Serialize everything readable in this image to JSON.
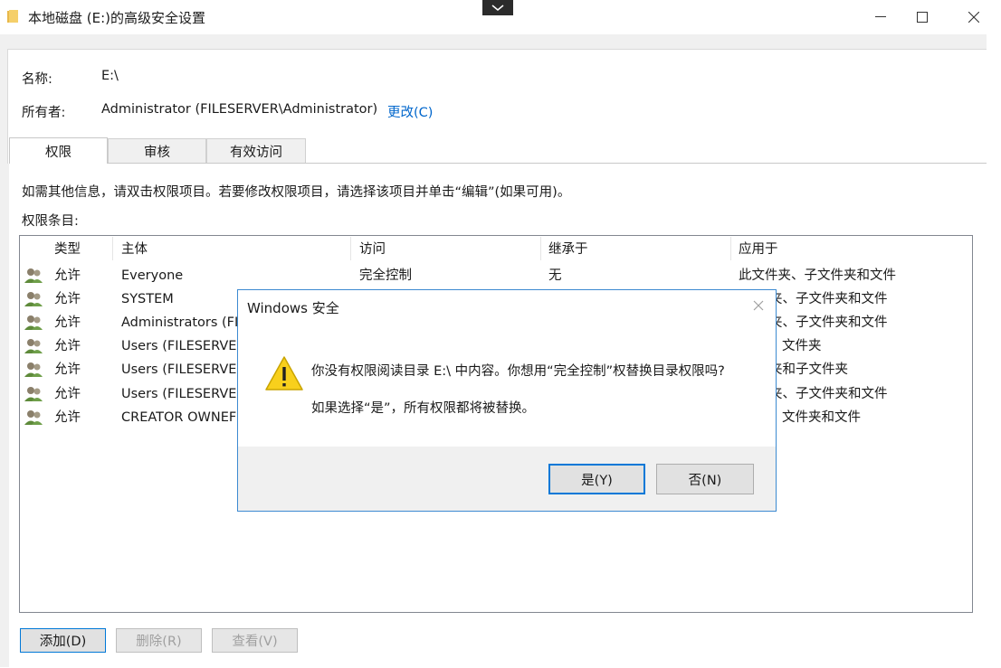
{
  "window": {
    "title": "本地磁盘 (E:)的高级安全设置",
    "icon": "folder-icon",
    "controls": [
      "minimize-icon",
      "maximize-icon",
      "close-icon"
    ]
  },
  "header": {
    "name_label": "名称:",
    "name_value": "E:\\",
    "owner_label": "所有者:",
    "owner_value": "Administrator (FILESERVER\\Administrator)",
    "change_link": "更改(C)"
  },
  "tabs": [
    {
      "label": "权限",
      "active": true
    },
    {
      "label": "审核",
      "active": false
    },
    {
      "label": "有效访问",
      "active": false
    }
  ],
  "permissions": {
    "info_text": "如需其他信息，请双击权限项目。若要修改权限项目，请选择该项目并单击“编辑”(如果可用)。",
    "entries_label": "权限条目:",
    "columns": [
      "类型",
      "主体",
      "访问",
      "继承于",
      "应用于"
    ],
    "rows": [
      {
        "type": "允许",
        "principal": "Everyone",
        "access": "完全控制",
        "inherited": "无",
        "applies": "此文件夹、子文件夹和文件"
      },
      {
        "type": "允许",
        "principal": "SYSTEM",
        "access": "",
        "inherited": "",
        "applies": "夹、子文件夹和文件"
      },
      {
        "type": "允许",
        "principal": "Administrators (FI",
        "access": "",
        "inherited": "",
        "applies": "夹、子文件夹和文件"
      },
      {
        "type": "允许",
        "principal": "Users (FILESERVEI",
        "access": "",
        "inherited": "",
        "applies": "文件夹"
      },
      {
        "type": "允许",
        "principal": "Users (FILESERVEI",
        "access": "",
        "inherited": "",
        "applies": "夹和子文件夹"
      },
      {
        "type": "允许",
        "principal": "Users (FILESERVEI",
        "access": "",
        "inherited": "",
        "applies": "夹、子文件夹和文件"
      },
      {
        "type": "允许",
        "principal": "CREATOR OWNEF",
        "access": "",
        "inherited": "",
        "applies": "文件夹和文件"
      }
    ],
    "buttons": {
      "add": "添加(D)",
      "remove": "删除(R)",
      "view": "查看(V)"
    }
  },
  "dialog": {
    "title": "Windows 安全",
    "message1": "你没有权限阅读目录 E:\\ 中内容。你想用“完全控制”权替换目录权限吗?",
    "message2": "如果选择“是”，所有权限都将被替换。",
    "yes": "是(Y)",
    "no": "否(N)",
    "icon": "warning-icon",
    "accent": "#0078d7"
  }
}
